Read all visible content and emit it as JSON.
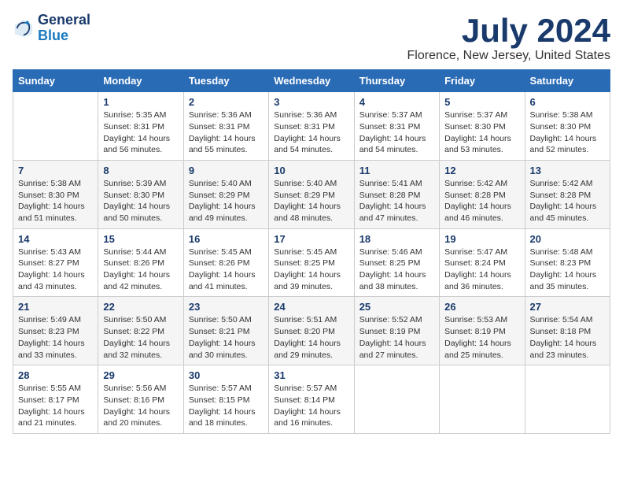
{
  "logo": {
    "line1": "General",
    "line2": "Blue"
  },
  "title": "July 2024",
  "subtitle": "Florence, New Jersey, United States",
  "header": {
    "colors": {
      "accent": "#2a6bb5"
    }
  },
  "days_of_week": [
    "Sunday",
    "Monday",
    "Tuesday",
    "Wednesday",
    "Thursday",
    "Friday",
    "Saturday"
  ],
  "weeks": [
    [
      {
        "day": "",
        "info": ""
      },
      {
        "day": "1",
        "info": "Sunrise: 5:35 AM\nSunset: 8:31 PM\nDaylight: 14 hours\nand 56 minutes."
      },
      {
        "day": "2",
        "info": "Sunrise: 5:36 AM\nSunset: 8:31 PM\nDaylight: 14 hours\nand 55 minutes."
      },
      {
        "day": "3",
        "info": "Sunrise: 5:36 AM\nSunset: 8:31 PM\nDaylight: 14 hours\nand 54 minutes."
      },
      {
        "day": "4",
        "info": "Sunrise: 5:37 AM\nSunset: 8:31 PM\nDaylight: 14 hours\nand 54 minutes."
      },
      {
        "day": "5",
        "info": "Sunrise: 5:37 AM\nSunset: 8:30 PM\nDaylight: 14 hours\nand 53 minutes."
      },
      {
        "day": "6",
        "info": "Sunrise: 5:38 AM\nSunset: 8:30 PM\nDaylight: 14 hours\nand 52 minutes."
      }
    ],
    [
      {
        "day": "7",
        "info": "Sunrise: 5:38 AM\nSunset: 8:30 PM\nDaylight: 14 hours\nand 51 minutes."
      },
      {
        "day": "8",
        "info": "Sunrise: 5:39 AM\nSunset: 8:30 PM\nDaylight: 14 hours\nand 50 minutes."
      },
      {
        "day": "9",
        "info": "Sunrise: 5:40 AM\nSunset: 8:29 PM\nDaylight: 14 hours\nand 49 minutes."
      },
      {
        "day": "10",
        "info": "Sunrise: 5:40 AM\nSunset: 8:29 PM\nDaylight: 14 hours\nand 48 minutes."
      },
      {
        "day": "11",
        "info": "Sunrise: 5:41 AM\nSunset: 8:28 PM\nDaylight: 14 hours\nand 47 minutes."
      },
      {
        "day": "12",
        "info": "Sunrise: 5:42 AM\nSunset: 8:28 PM\nDaylight: 14 hours\nand 46 minutes."
      },
      {
        "day": "13",
        "info": "Sunrise: 5:42 AM\nSunset: 8:28 PM\nDaylight: 14 hours\nand 45 minutes."
      }
    ],
    [
      {
        "day": "14",
        "info": "Sunrise: 5:43 AM\nSunset: 8:27 PM\nDaylight: 14 hours\nand 43 minutes."
      },
      {
        "day": "15",
        "info": "Sunrise: 5:44 AM\nSunset: 8:26 PM\nDaylight: 14 hours\nand 42 minutes."
      },
      {
        "day": "16",
        "info": "Sunrise: 5:45 AM\nSunset: 8:26 PM\nDaylight: 14 hours\nand 41 minutes."
      },
      {
        "day": "17",
        "info": "Sunrise: 5:45 AM\nSunset: 8:25 PM\nDaylight: 14 hours\nand 39 minutes."
      },
      {
        "day": "18",
        "info": "Sunrise: 5:46 AM\nSunset: 8:25 PM\nDaylight: 14 hours\nand 38 minutes."
      },
      {
        "day": "19",
        "info": "Sunrise: 5:47 AM\nSunset: 8:24 PM\nDaylight: 14 hours\nand 36 minutes."
      },
      {
        "day": "20",
        "info": "Sunrise: 5:48 AM\nSunset: 8:23 PM\nDaylight: 14 hours\nand 35 minutes."
      }
    ],
    [
      {
        "day": "21",
        "info": "Sunrise: 5:49 AM\nSunset: 8:23 PM\nDaylight: 14 hours\nand 33 minutes."
      },
      {
        "day": "22",
        "info": "Sunrise: 5:50 AM\nSunset: 8:22 PM\nDaylight: 14 hours\nand 32 minutes."
      },
      {
        "day": "23",
        "info": "Sunrise: 5:50 AM\nSunset: 8:21 PM\nDaylight: 14 hours\nand 30 minutes."
      },
      {
        "day": "24",
        "info": "Sunrise: 5:51 AM\nSunset: 8:20 PM\nDaylight: 14 hours\nand 29 minutes."
      },
      {
        "day": "25",
        "info": "Sunrise: 5:52 AM\nSunset: 8:19 PM\nDaylight: 14 hours\nand 27 minutes."
      },
      {
        "day": "26",
        "info": "Sunrise: 5:53 AM\nSunset: 8:19 PM\nDaylight: 14 hours\nand 25 minutes."
      },
      {
        "day": "27",
        "info": "Sunrise: 5:54 AM\nSunset: 8:18 PM\nDaylight: 14 hours\nand 23 minutes."
      }
    ],
    [
      {
        "day": "28",
        "info": "Sunrise: 5:55 AM\nSunset: 8:17 PM\nDaylight: 14 hours\nand 21 minutes."
      },
      {
        "day": "29",
        "info": "Sunrise: 5:56 AM\nSunset: 8:16 PM\nDaylight: 14 hours\nand 20 minutes."
      },
      {
        "day": "30",
        "info": "Sunrise: 5:57 AM\nSunset: 8:15 PM\nDaylight: 14 hours\nand 18 minutes."
      },
      {
        "day": "31",
        "info": "Sunrise: 5:57 AM\nSunset: 8:14 PM\nDaylight: 14 hours\nand 16 minutes."
      },
      {
        "day": "",
        "info": ""
      },
      {
        "day": "",
        "info": ""
      },
      {
        "day": "",
        "info": ""
      }
    ]
  ]
}
